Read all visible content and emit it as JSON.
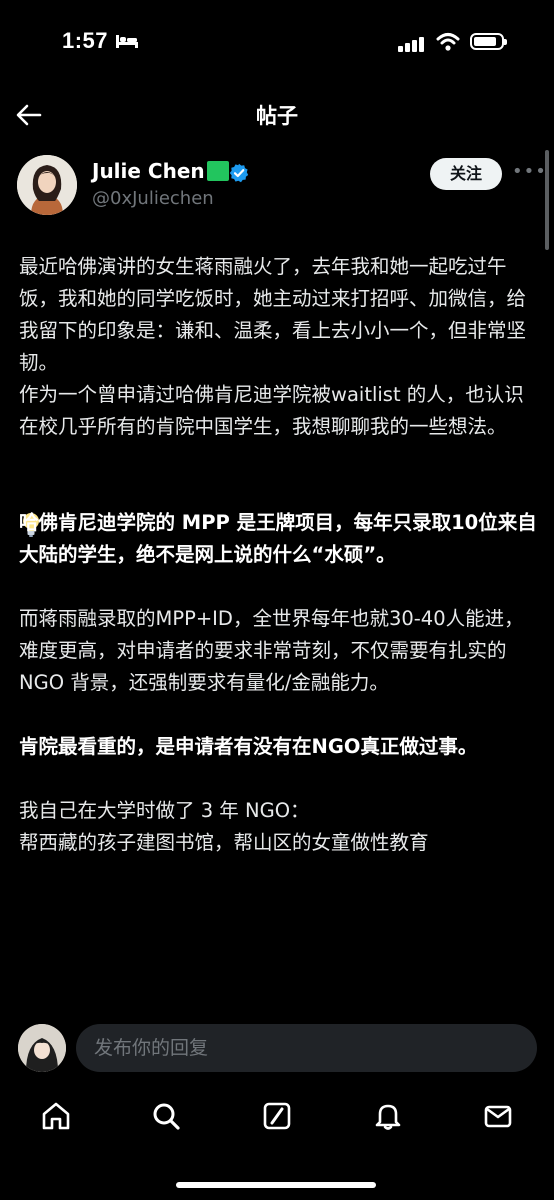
{
  "status_bar": {
    "time": "1:57"
  },
  "nav": {
    "title": "帖子"
  },
  "post": {
    "author_name": "Julie Chen",
    "handle": "@0xJuliechen",
    "follow_label": "关注",
    "paragraphs": [
      "最近哈佛演讲的女生蒋雨融火了，去年我和她一起吃过午饭，我和她的同学吃饭时，她主动过来打招呼、加微信，给我留下的印象是：谦和、温柔，看上去小小一个，但非常坚韧。",
      "作为一个曾申请过哈佛肯尼迪学院被waitlist 的人，也认识在校几乎所有的肯院中国学生，我想聊聊我的一些想法。",
      "哈佛肯尼迪学院的 MPP 是王牌项目，每年只录取10位来自大陆的学生，绝不是网上说的什么“水硕”。",
      "而蒋雨融录取的MPP+ID，全世界每年也就30-40人能进，难度更高，对申请者的要求非常苛刻，不仅需要有扎实的 NGO 背景，还强制要求有量化/金融能力。",
      "肯院最看重的，是申请者有没有在NGO真正做过事。",
      "我自己在大学时做了 3 年 NGO：",
      "帮西藏的孩子建图书馆，帮山区的女童做性教育"
    ]
  },
  "reply": {
    "placeholder": "发布你的回复"
  },
  "colors": {
    "accent": "#1d9bf0",
    "verified": "#1d9bf0",
    "background": "#000000"
  }
}
